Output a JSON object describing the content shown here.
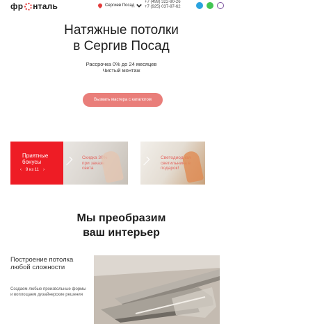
{
  "header": {
    "logo_left": "фр",
    "logo_right": "нталь",
    "city": "Сергиев Посад",
    "phones": [
      "+7 (499) 322-90-26",
      "+7 (925) 037-97-62"
    ],
    "messengers": [
      {
        "name": "telegram-icon",
        "color": "#2aa3df"
      },
      {
        "name": "whatsapp-icon",
        "color": "#43c553"
      },
      {
        "name": "viber-icon",
        "color": "#7b519d"
      }
    ]
  },
  "hero": {
    "title_line1": "Натяжные потолки",
    "title_line2": "в Сергив Посад",
    "sub_line1": "Рассрочка 0% до 24 месяцев",
    "sub_line2": "Чистый монтаж",
    "cta_label": "Вызвать мастера с каталогом"
  },
  "promos": {
    "title_line1": "Приятные",
    "title_line2": "бонусы",
    "counter": "9 из 11",
    "prev": "‹",
    "next": "›",
    "cards": [
      {
        "line1": "Скидка 30%",
        "line2": "при заказе",
        "line3": "света"
      },
      {
        "line1": "Светодиодная",
        "line2": "светильника в",
        "line3": "подарок!"
      }
    ]
  },
  "section": {
    "title_line1": "Мы преобразим",
    "title_line2": "ваш интерьер"
  },
  "feature": {
    "title": "Построение потолка любой сложности",
    "text": "Создаем любые произвольные формы и воплощаем дизайнерские решения"
  },
  "colors": {
    "accent": "#e33b3b",
    "cta": "#e97e7a",
    "promo_red": "#ee1c25"
  }
}
